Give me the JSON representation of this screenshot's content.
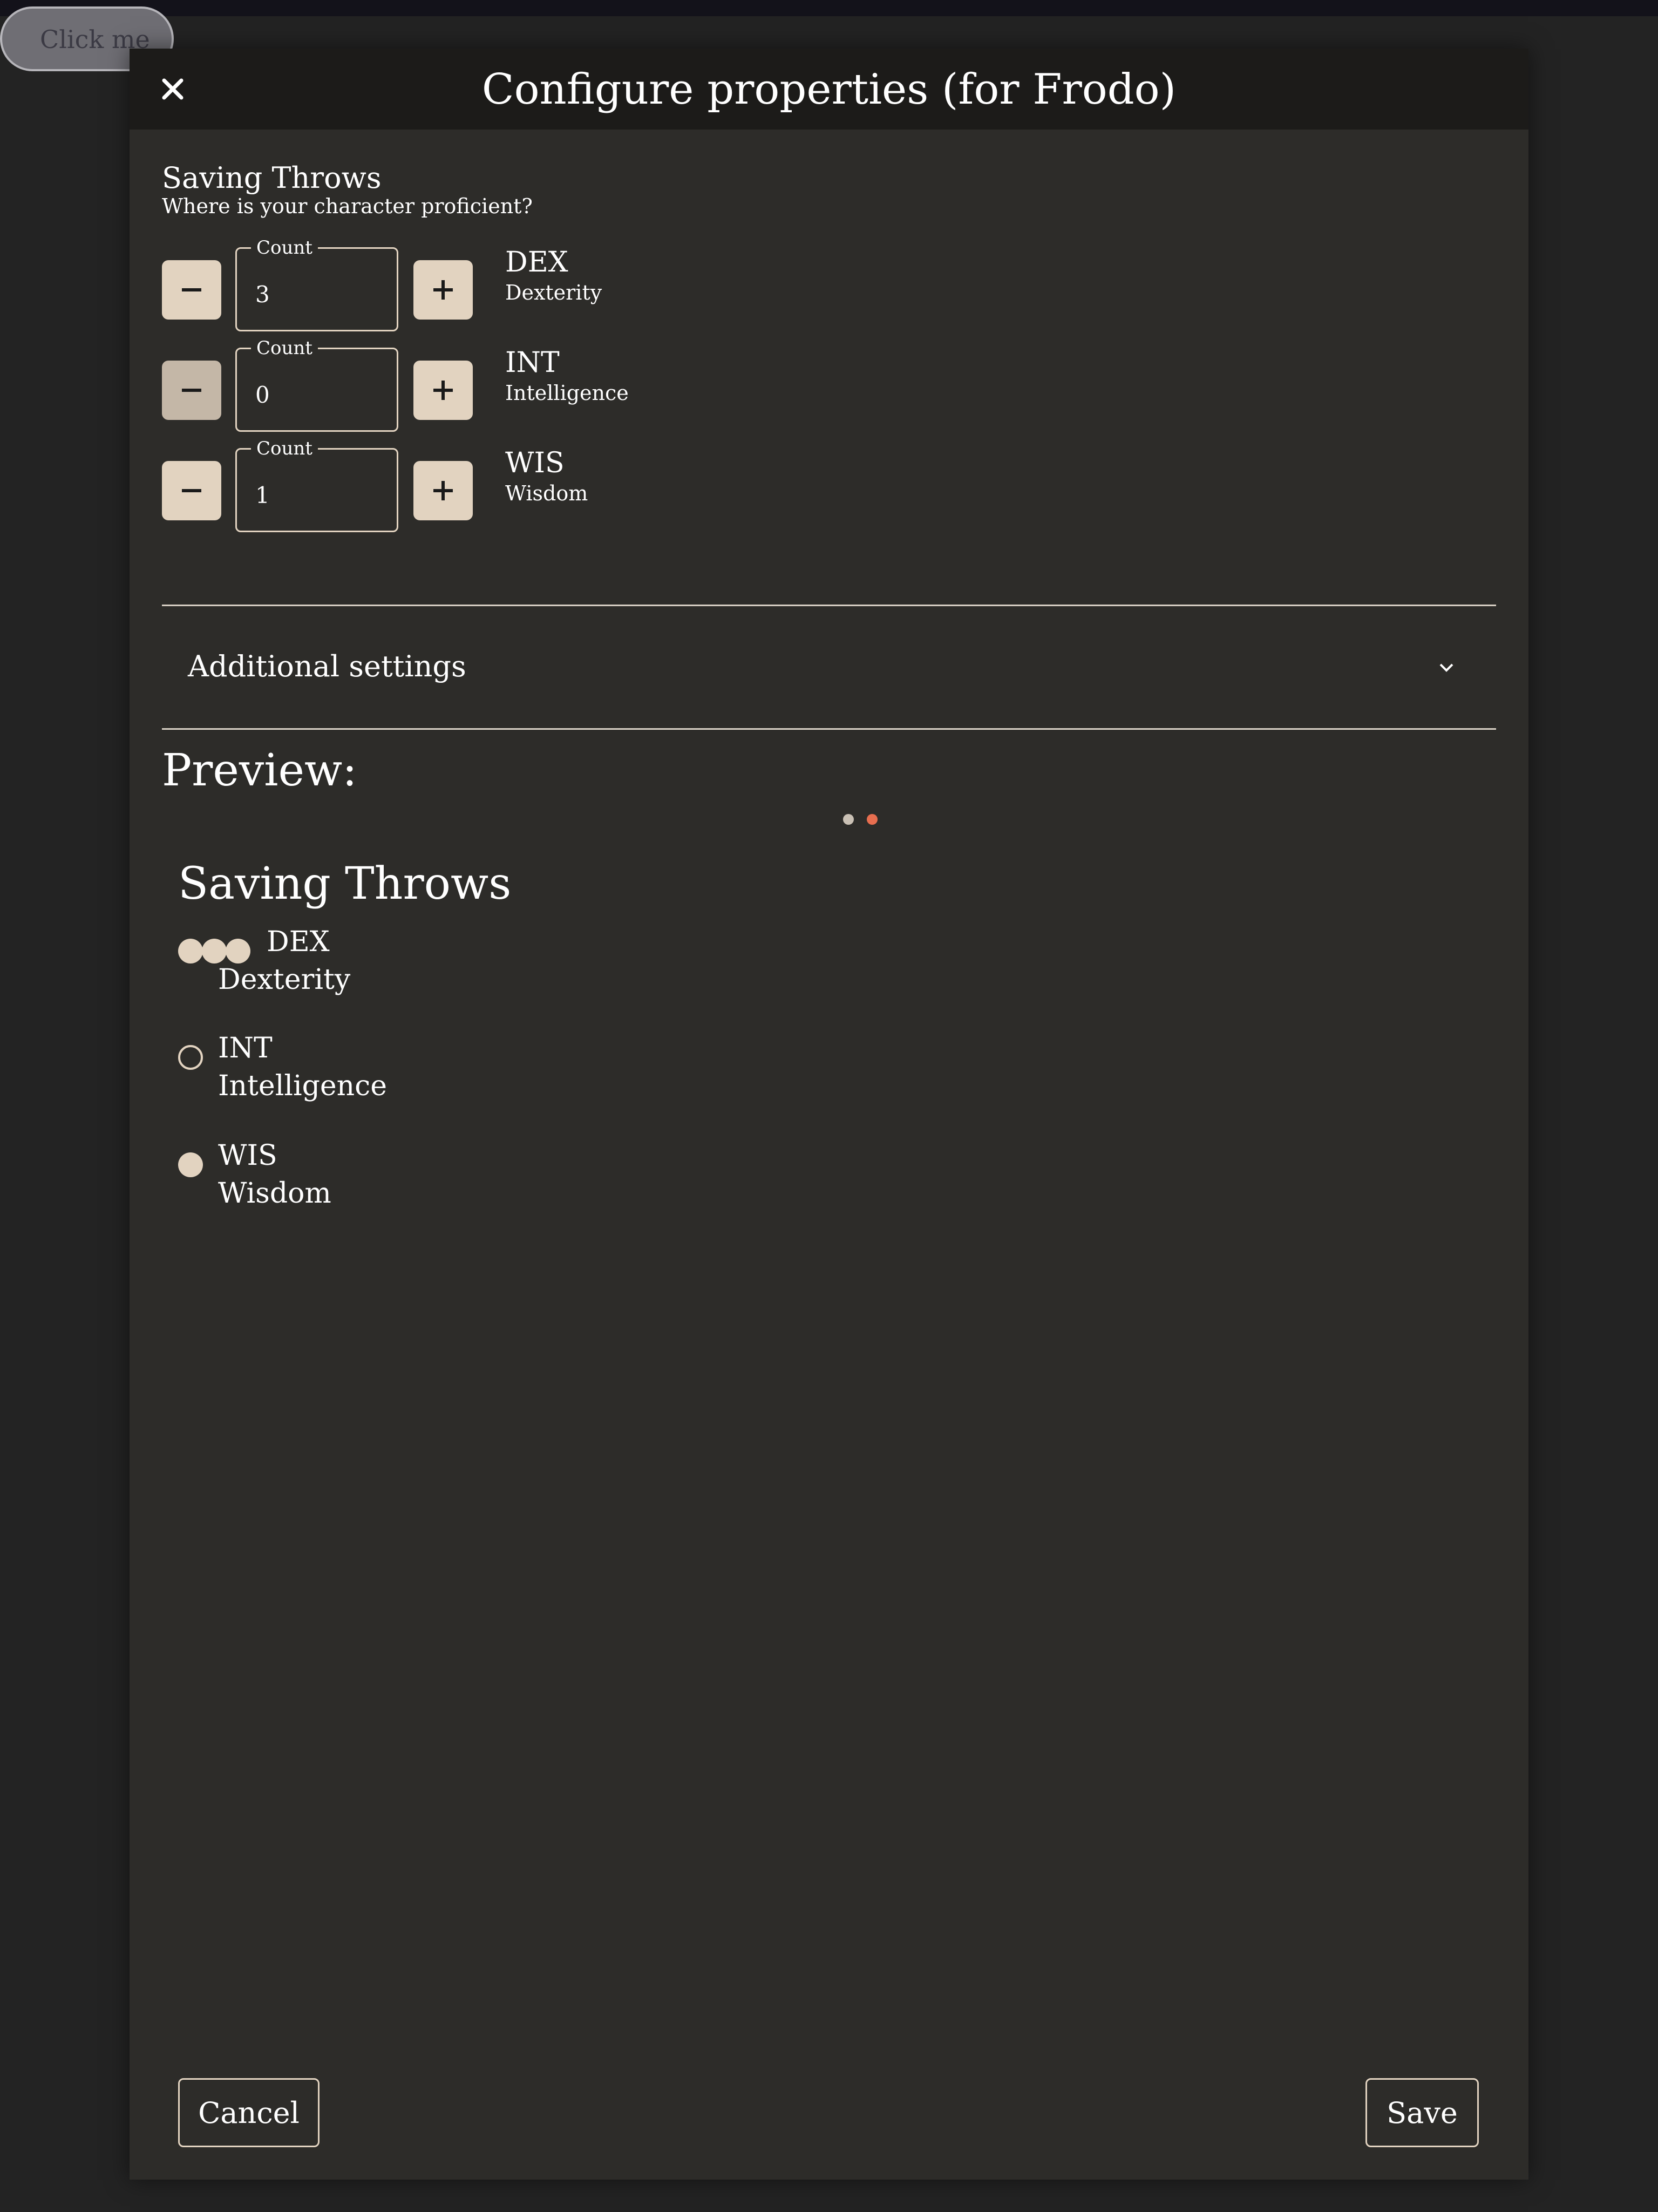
{
  "background": {
    "button_label": "Click me"
  },
  "dialog": {
    "title": "Configure properties (for Frodo)",
    "close_icon": "close-icon",
    "section": {
      "title": "Saving Throws",
      "subtitle": "Where is your character proficient?"
    },
    "field_label": "Count",
    "properties": [
      {
        "abbr": "DEX",
        "name": "Dexterity",
        "count": "3",
        "minus_enabled": true
      },
      {
        "abbr": "INT",
        "name": "Intelligence",
        "count": "0",
        "minus_enabled": false
      },
      {
        "abbr": "WIS",
        "name": "Wisdom",
        "count": "1",
        "minus_enabled": true
      }
    ],
    "accordion": {
      "label": "Additional settings",
      "icon": "chevron-down-icon",
      "expanded": false
    },
    "preview": {
      "heading": "Preview:",
      "pager": {
        "pages": 2,
        "active_page": 2,
        "dot_color": "#c9c0b4",
        "active_color": "#e76e4f"
      },
      "title": "Saving Throws",
      "items": [
        {
          "abbr": "DEX",
          "name": "Dexterity",
          "pips": 3
        },
        {
          "abbr": "INT",
          "name": "Intelligence",
          "pips": 0
        },
        {
          "abbr": "WIS",
          "name": "Wisdom",
          "pips": 1
        }
      ]
    },
    "footer": {
      "cancel_label": "Cancel",
      "save_label": "Save"
    }
  },
  "colors": {
    "dialog_bg": "#2d2c29",
    "header_bg": "#1c1b19",
    "accent": "#e2d3c0",
    "page_bg": "#232323"
  }
}
